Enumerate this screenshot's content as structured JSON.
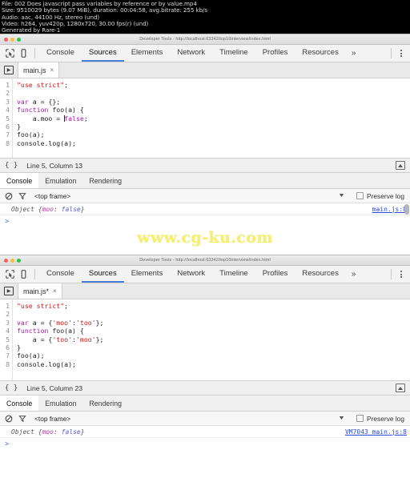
{
  "media_info": {
    "lines": [
      "File: 002 Does javascript pass variables by reference or by value.mp4",
      "Size: 9510029 bytes (9.07 MiB), duration: 00:04:58, avg.bitrate: 255 kb/s",
      "Audio: aac, 44100 Hz, stereo (und)",
      "Video: h264, yuv420p, 1280x720, 30.00 fps(r) (und)",
      "Generated by Rare-1"
    ]
  },
  "watermark": "www.cg-ku.com",
  "toolbar_common": {
    "tabs": [
      {
        "label": "Console",
        "active": false
      },
      {
        "label": "Sources",
        "active": true
      },
      {
        "label": "Elements",
        "active": false
      },
      {
        "label": "Network",
        "active": false
      },
      {
        "label": "Timeline",
        "active": false
      },
      {
        "label": "Profiles",
        "active": false
      },
      {
        "label": "Resources",
        "active": false
      }
    ],
    "overflow_label": "»",
    "inspect_icon": "inspect-element-icon",
    "device_icon": "device-toolbar-icon",
    "menu_icon": "kebab-menu-icon"
  },
  "drawer_common": {
    "tabs": [
      {
        "label": "Console",
        "active": true
      },
      {
        "label": "Emulation",
        "active": false
      },
      {
        "label": "Rendering",
        "active": false
      }
    ],
    "clear_icon": "clear-console-icon",
    "filter_icon": "filter-funnel-icon",
    "frame_value": "<top frame>",
    "dropdown_icon": "chevron-down-icon",
    "preserve_label": "Preserve log",
    "prompt_symbol": ">"
  },
  "panel_one": {
    "title_bar": {
      "title": "Developer Tools - http://localhost:63342/top10interview/index.html",
      "traffic_lights": [
        "close",
        "minimize",
        "zoom"
      ]
    },
    "file_tab": {
      "name": "main.js",
      "close_label": "×",
      "nav_toggle_icon": "show-navigator-icon"
    },
    "editor": {
      "line_numbers": [
        "1",
        "2",
        "3",
        "4",
        "5",
        "6",
        "7",
        "8"
      ],
      "lines": [
        "\"use strict\";",
        "",
        "var a = {};",
        "function foo(a) {",
        "    a.moo = false;",
        "}",
        "foo(a);",
        "console.log(a);"
      ]
    },
    "status": {
      "format_icon": "pretty-print-braces-icon",
      "position": "Line 5, Column 13",
      "toggle_drawer_icon": "toggle-drawer-icon"
    },
    "console": {
      "log_prefix": "Object ",
      "log_object": "{moo: false}",
      "log_prop": "moo",
      "log_value": "false",
      "source": "main.js:8"
    }
  },
  "panel_two": {
    "title_bar": {
      "title": "Developer Tools - http://localhost:63342/top10interview/index.html",
      "traffic_lights": [
        "close",
        "minimize",
        "zoom"
      ]
    },
    "file_tab": {
      "name": "main.js*",
      "close_label": "×",
      "nav_toggle_icon": "show-navigator-icon"
    },
    "editor": {
      "line_numbers": [
        "1",
        "2",
        "3",
        "4",
        "5",
        "6",
        "7",
        "8"
      ],
      "lines": [
        "\"use strict\";",
        "",
        "var a = {'moo':'too'};",
        "function foo(a) {",
        "    a = {'too':'moo'};",
        "}",
        "foo(a);",
        "console.log(a);"
      ]
    },
    "status": {
      "format_icon": "pretty-print-braces-icon",
      "position": "Line 5, Column 23",
      "toggle_drawer_icon": "toggle-drawer-icon"
    },
    "console": {
      "log_prefix": "Object ",
      "log_object": "{moo: false}",
      "log_prop": "moo",
      "log_value": "false",
      "source": "VM7043 main.js:8"
    }
  }
}
